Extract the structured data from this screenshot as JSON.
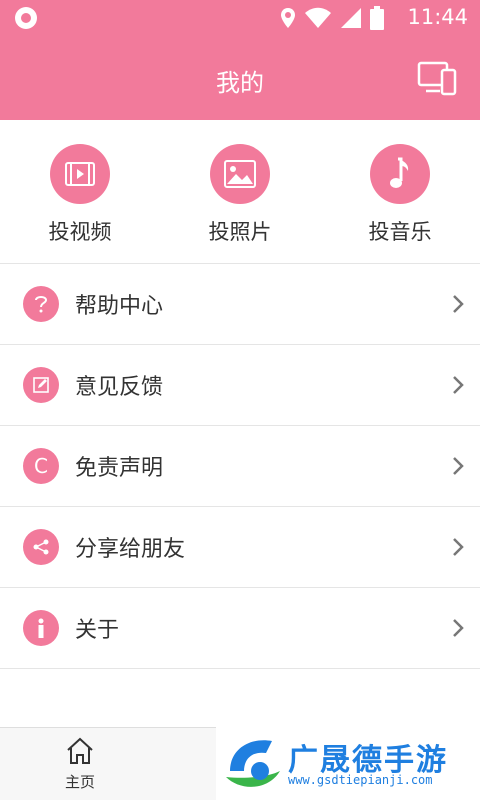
{
  "status_bar": {
    "time": "11:44",
    "icons": [
      "notification-circle-icon",
      "location-icon",
      "wifi-icon",
      "signal-icon",
      "battery-icon"
    ]
  },
  "header": {
    "title": "我的",
    "right_icon": "devices-icon"
  },
  "quick_actions": [
    {
      "label": "投视频",
      "icon": "video-icon"
    },
    {
      "label": "投照片",
      "icon": "photo-icon"
    },
    {
      "label": "投音乐",
      "icon": "music-note-icon"
    }
  ],
  "menu": [
    {
      "label": "帮助中心",
      "icon": "question-icon"
    },
    {
      "label": "意见反馈",
      "icon": "edit-icon"
    },
    {
      "label": "免责声明",
      "icon": "copyright-icon",
      "icon_text": "C"
    },
    {
      "label": "分享给朋友",
      "icon": "share-icon"
    },
    {
      "label": "关于",
      "icon": "info-icon"
    }
  ],
  "tabbar": {
    "home_label": "主页"
  },
  "watermark": {
    "text": "广晟德手游",
    "url": "www.gsdtiepianji.com"
  },
  "colors": {
    "accent": "#f27a9b",
    "text": "#333333",
    "divider": "#e5e5e5"
  }
}
